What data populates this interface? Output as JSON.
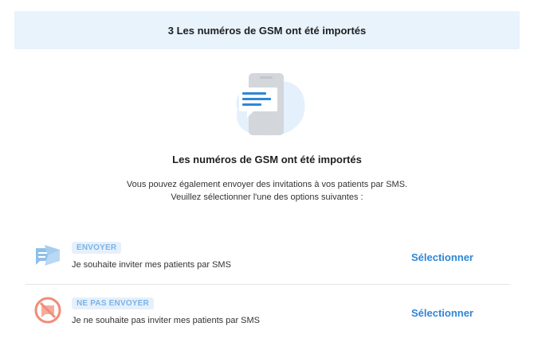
{
  "banner": {
    "message": "3 Les numéros de GSM ont été importés"
  },
  "main": {
    "heading": "Les numéros de GSM ont été importés",
    "description_line1": "Vous pouvez également envoyer des invitations à vos patients par SMS.",
    "description_line2": "Veuillez sélectionner l'une des options suivantes :"
  },
  "options": [
    {
      "badge": "ENVOYER",
      "text": "Je souhaite inviter mes patients par SMS",
      "action": "Sélectionner",
      "icon": "send-message-icon"
    },
    {
      "badge": "NE PAS ENVOYER",
      "text": "Je ne souhaite pas inviter mes patients par SMS",
      "action": "Sélectionner",
      "icon": "no-message-icon"
    }
  ],
  "colors": {
    "banner_bg": "#e8f3fc",
    "accent": "#2f86d6",
    "badge_text": "#7ab3e6",
    "badge_bg": "#e6f0fb",
    "send_icon": "#8fc0ea",
    "no_send_icon": "#f08c78"
  }
}
